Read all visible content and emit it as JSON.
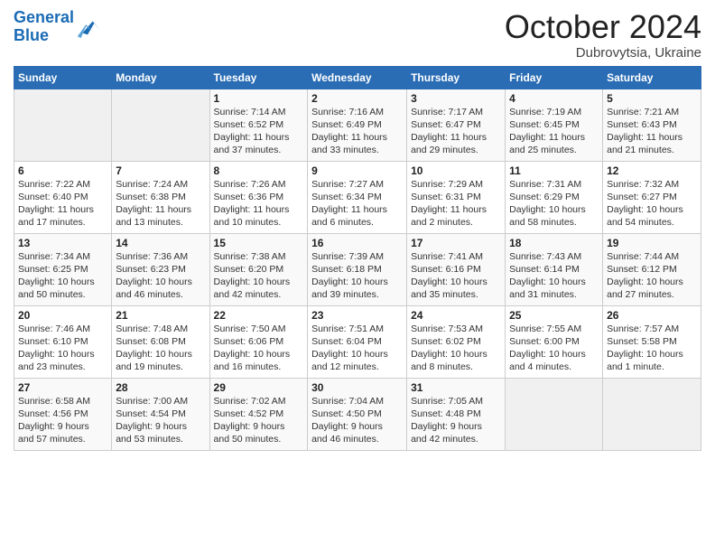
{
  "header": {
    "logo_line1": "General",
    "logo_line2": "Blue",
    "month": "October 2024",
    "location": "Dubrovytsia, Ukraine"
  },
  "weekdays": [
    "Sunday",
    "Monday",
    "Tuesday",
    "Wednesday",
    "Thursday",
    "Friday",
    "Saturday"
  ],
  "weeks": [
    [
      {
        "day": "",
        "info": ""
      },
      {
        "day": "",
        "info": ""
      },
      {
        "day": "1",
        "info": "Sunrise: 7:14 AM\nSunset: 6:52 PM\nDaylight: 11 hours\nand 37 minutes."
      },
      {
        "day": "2",
        "info": "Sunrise: 7:16 AM\nSunset: 6:49 PM\nDaylight: 11 hours\nand 33 minutes."
      },
      {
        "day": "3",
        "info": "Sunrise: 7:17 AM\nSunset: 6:47 PM\nDaylight: 11 hours\nand 29 minutes."
      },
      {
        "day": "4",
        "info": "Sunrise: 7:19 AM\nSunset: 6:45 PM\nDaylight: 11 hours\nand 25 minutes."
      },
      {
        "day": "5",
        "info": "Sunrise: 7:21 AM\nSunset: 6:43 PM\nDaylight: 11 hours\nand 21 minutes."
      }
    ],
    [
      {
        "day": "6",
        "info": "Sunrise: 7:22 AM\nSunset: 6:40 PM\nDaylight: 11 hours\nand 17 minutes."
      },
      {
        "day": "7",
        "info": "Sunrise: 7:24 AM\nSunset: 6:38 PM\nDaylight: 11 hours\nand 13 minutes."
      },
      {
        "day": "8",
        "info": "Sunrise: 7:26 AM\nSunset: 6:36 PM\nDaylight: 11 hours\nand 10 minutes."
      },
      {
        "day": "9",
        "info": "Sunrise: 7:27 AM\nSunset: 6:34 PM\nDaylight: 11 hours\nand 6 minutes."
      },
      {
        "day": "10",
        "info": "Sunrise: 7:29 AM\nSunset: 6:31 PM\nDaylight: 11 hours\nand 2 minutes."
      },
      {
        "day": "11",
        "info": "Sunrise: 7:31 AM\nSunset: 6:29 PM\nDaylight: 10 hours\nand 58 minutes."
      },
      {
        "day": "12",
        "info": "Sunrise: 7:32 AM\nSunset: 6:27 PM\nDaylight: 10 hours\nand 54 minutes."
      }
    ],
    [
      {
        "day": "13",
        "info": "Sunrise: 7:34 AM\nSunset: 6:25 PM\nDaylight: 10 hours\nand 50 minutes."
      },
      {
        "day": "14",
        "info": "Sunrise: 7:36 AM\nSunset: 6:23 PM\nDaylight: 10 hours\nand 46 minutes."
      },
      {
        "day": "15",
        "info": "Sunrise: 7:38 AM\nSunset: 6:20 PM\nDaylight: 10 hours\nand 42 minutes."
      },
      {
        "day": "16",
        "info": "Sunrise: 7:39 AM\nSunset: 6:18 PM\nDaylight: 10 hours\nand 39 minutes."
      },
      {
        "day": "17",
        "info": "Sunrise: 7:41 AM\nSunset: 6:16 PM\nDaylight: 10 hours\nand 35 minutes."
      },
      {
        "day": "18",
        "info": "Sunrise: 7:43 AM\nSunset: 6:14 PM\nDaylight: 10 hours\nand 31 minutes."
      },
      {
        "day": "19",
        "info": "Sunrise: 7:44 AM\nSunset: 6:12 PM\nDaylight: 10 hours\nand 27 minutes."
      }
    ],
    [
      {
        "day": "20",
        "info": "Sunrise: 7:46 AM\nSunset: 6:10 PM\nDaylight: 10 hours\nand 23 minutes."
      },
      {
        "day": "21",
        "info": "Sunrise: 7:48 AM\nSunset: 6:08 PM\nDaylight: 10 hours\nand 19 minutes."
      },
      {
        "day": "22",
        "info": "Sunrise: 7:50 AM\nSunset: 6:06 PM\nDaylight: 10 hours\nand 16 minutes."
      },
      {
        "day": "23",
        "info": "Sunrise: 7:51 AM\nSunset: 6:04 PM\nDaylight: 10 hours\nand 12 minutes."
      },
      {
        "day": "24",
        "info": "Sunrise: 7:53 AM\nSunset: 6:02 PM\nDaylight: 10 hours\nand 8 minutes."
      },
      {
        "day": "25",
        "info": "Sunrise: 7:55 AM\nSunset: 6:00 PM\nDaylight: 10 hours\nand 4 minutes."
      },
      {
        "day": "26",
        "info": "Sunrise: 7:57 AM\nSunset: 5:58 PM\nDaylight: 10 hours\nand 1 minute."
      }
    ],
    [
      {
        "day": "27",
        "info": "Sunrise: 6:58 AM\nSunset: 4:56 PM\nDaylight: 9 hours\nand 57 minutes."
      },
      {
        "day": "28",
        "info": "Sunrise: 7:00 AM\nSunset: 4:54 PM\nDaylight: 9 hours\nand 53 minutes."
      },
      {
        "day": "29",
        "info": "Sunrise: 7:02 AM\nSunset: 4:52 PM\nDaylight: 9 hours\nand 50 minutes."
      },
      {
        "day": "30",
        "info": "Sunrise: 7:04 AM\nSunset: 4:50 PM\nDaylight: 9 hours\nand 46 minutes."
      },
      {
        "day": "31",
        "info": "Sunrise: 7:05 AM\nSunset: 4:48 PM\nDaylight: 9 hours\nand 42 minutes."
      },
      {
        "day": "",
        "info": ""
      },
      {
        "day": "",
        "info": ""
      }
    ]
  ]
}
